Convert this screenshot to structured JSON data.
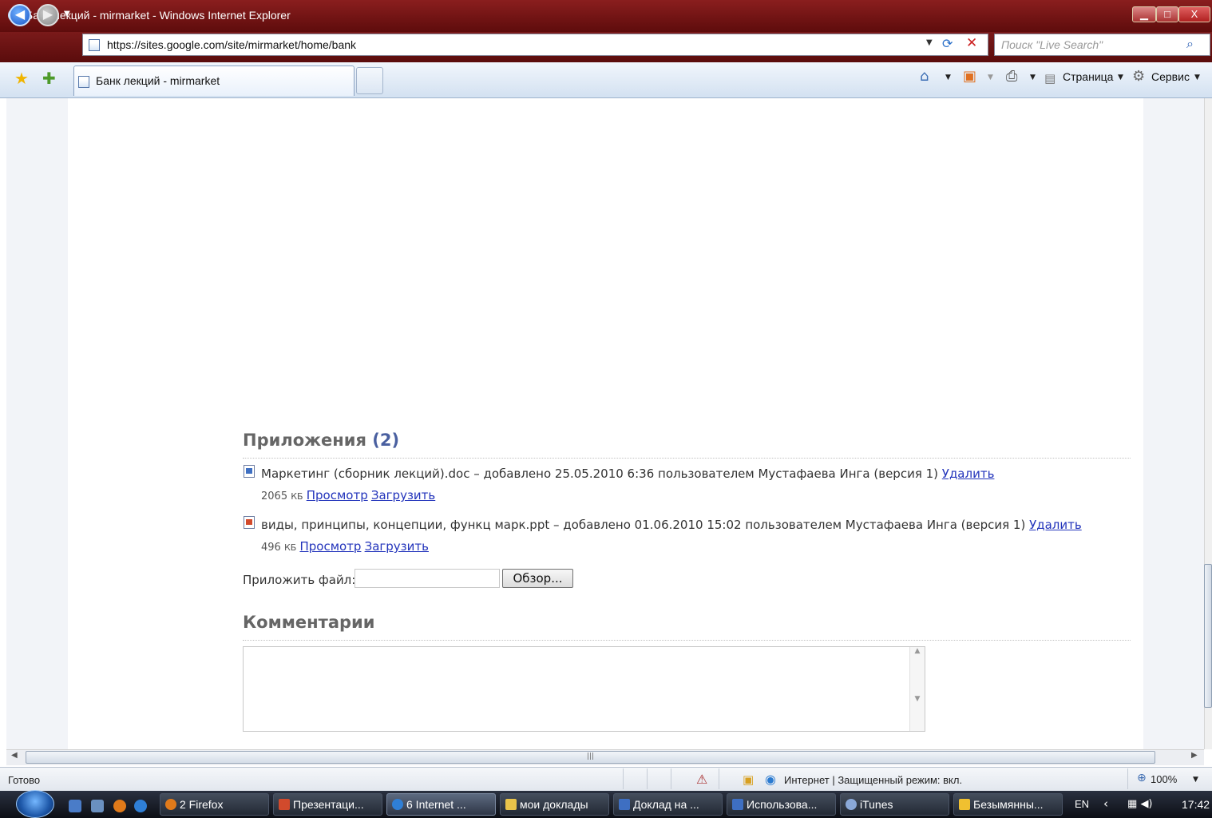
{
  "window": {
    "title": "Банк лекций - mirmarket - Windows Internet Explorer",
    "controls": {
      "minimize": "▁",
      "maximize": "□",
      "close": "X"
    }
  },
  "address_bar": {
    "url": "https://sites.google.com/site/mirmarket/home/bank",
    "search_placeholder": "Поиск \"Live Search\""
  },
  "tabs": [
    {
      "label": "Банк лекций - mirmarket"
    }
  ],
  "command_bar": {
    "page_menu": "Страница",
    "tools_menu": "Сервис"
  },
  "attachments": {
    "heading": "Приложения",
    "count": "(2)",
    "files": [
      {
        "name_line": "Маркетинг (сборник лекций).doc – добавлено 25.05.2010 6:36 пользователем Мустафаева Инга (версия 1)",
        "delete": "Удалить",
        "size": "2065",
        "size_unit": "КБ",
        "view": "Просмотр",
        "download": "Загрузить",
        "icon": "word-doc-icon"
      },
      {
        "name_line": "виды, принципы, концепции, функц марк.ppt – добавлено 01.06.2010 15:02 пользователем Мустафаева Инга (версия 1)",
        "delete": "Удалить",
        "size": "496",
        "size_unit": "КБ",
        "view": "Просмотр",
        "download": "Загрузить",
        "icon": "powerpoint-icon"
      }
    ],
    "attach_label": "Приложить файл:",
    "browse_button": "Обзор..."
  },
  "comments": {
    "heading": "Комментарии"
  },
  "status_bar": {
    "status": "Готово",
    "zone": "Интернет | Защищенный режим: вкл.",
    "zoom": "100%"
  },
  "taskbar": {
    "tasks": [
      {
        "label": "2 Firefox",
        "color": "#e07a1a"
      },
      {
        "label": "Презентаци...",
        "color": "#d24a2c"
      },
      {
        "label": "6 Internet ...",
        "color": "#2f7fd6"
      },
      {
        "label": "мои доклады",
        "color": "#e8c34a"
      },
      {
        "label": "Доклад на ...",
        "color": "#3e6fc2"
      },
      {
        "label": "Использова...",
        "color": "#3e6fc2"
      },
      {
        "label": "iTunes",
        "color": "#8aa8d8"
      },
      {
        "label": "Безымянны...",
        "color": "#f0c030"
      }
    ],
    "language": "EN",
    "clock": "17:42"
  },
  "colors": {
    "title_bar": "#7a1a1a",
    "link": "#2233bb",
    "heading": "#666666",
    "count_accent": "#4a60a0"
  }
}
